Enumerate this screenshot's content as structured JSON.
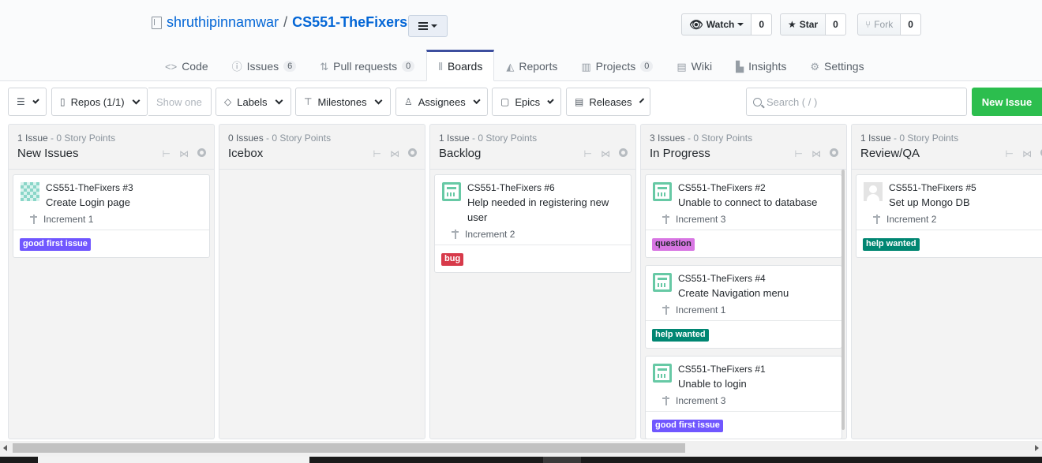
{
  "repo": {
    "owner": "shruthipinnamwar",
    "separator": "/",
    "name": "CS551-TheFixers"
  },
  "actions": {
    "watch": {
      "label": "Watch",
      "count": "0"
    },
    "star": {
      "label": "Star",
      "count": "0"
    },
    "fork": {
      "label": "Fork",
      "count": "0"
    }
  },
  "nav": [
    {
      "label": "Code",
      "icon": "code-icon"
    },
    {
      "label": "Issues",
      "icon": "issue-icon",
      "count": "6"
    },
    {
      "label": "Pull requests",
      "icon": "pull-request-icon",
      "count": "0"
    },
    {
      "label": "Boards",
      "icon": "boards-icon",
      "selected": true
    },
    {
      "label": "Reports",
      "icon": "reports-icon"
    },
    {
      "label": "Projects",
      "icon": "projects-icon",
      "count": "0"
    },
    {
      "label": "Wiki",
      "icon": "wiki-icon"
    },
    {
      "label": "Insights",
      "icon": "insights-icon"
    },
    {
      "label": "Settings",
      "icon": "gear-icon"
    }
  ],
  "toolbar": {
    "repos": "Repos (1/1)",
    "show_one": "Show one",
    "labels": "Labels",
    "milestones": "Milestones",
    "assignees": "Assignees",
    "epics": "Epics",
    "releases": "Releases",
    "search_placeholder": "Search ( / )",
    "new_issue": "New Issue"
  },
  "pipelines": [
    {
      "count": "1 Issue",
      "points": " - 0 Story Points",
      "name": "New Issues",
      "cards": [
        {
          "avatar": "identicon",
          "repo": "CS551-TheFixers #3",
          "title": "Create Login page",
          "milestone": "Increment 1",
          "label": "good first issue",
          "label_color": "#7057ff"
        }
      ]
    },
    {
      "count": "0 Issues",
      "points": " - 0 Story Points",
      "name": "Icebox",
      "cards": []
    },
    {
      "count": "1 Issue",
      "points": " - 0 Story Points",
      "name": "Backlog",
      "cards": [
        {
          "avatar": "robot",
          "repo": "CS551-TheFixers #6",
          "title": "Help needed in registering new user",
          "milestone": "Increment 2",
          "label": "bug",
          "label_color": "#d73a4a"
        }
      ]
    },
    {
      "count": "3 Issues",
      "points": " - 0 Story Points",
      "name": "In Progress",
      "cards": [
        {
          "avatar": "robot",
          "repo": "CS551-TheFixers #2",
          "title": "Unable to connect to database",
          "milestone": "Increment 3",
          "label": "question",
          "label_color": "#d876e3",
          "label_text_color": "#24292e"
        },
        {
          "avatar": "robot",
          "repo": "CS551-TheFixers #4",
          "title": "Create Navigation menu",
          "milestone": "Increment 1",
          "label": "help wanted",
          "label_color": "#008672"
        },
        {
          "avatar": "robot",
          "repo": "CS551-TheFixers #1",
          "title": "Unable to login",
          "milestone": "Increment 3",
          "label": "good first issue",
          "label_color": "#7057ff"
        }
      ]
    },
    {
      "count": "1 Issue",
      "points": " - 0 Story Points",
      "name": "Review/QA",
      "cards": [
        {
          "avatar": "default",
          "repo": "CS551-TheFixers #5",
          "title": "Set up Mongo DB",
          "milestone": "Increment 2",
          "label": "help wanted",
          "label_color": "#008672"
        }
      ]
    }
  ]
}
